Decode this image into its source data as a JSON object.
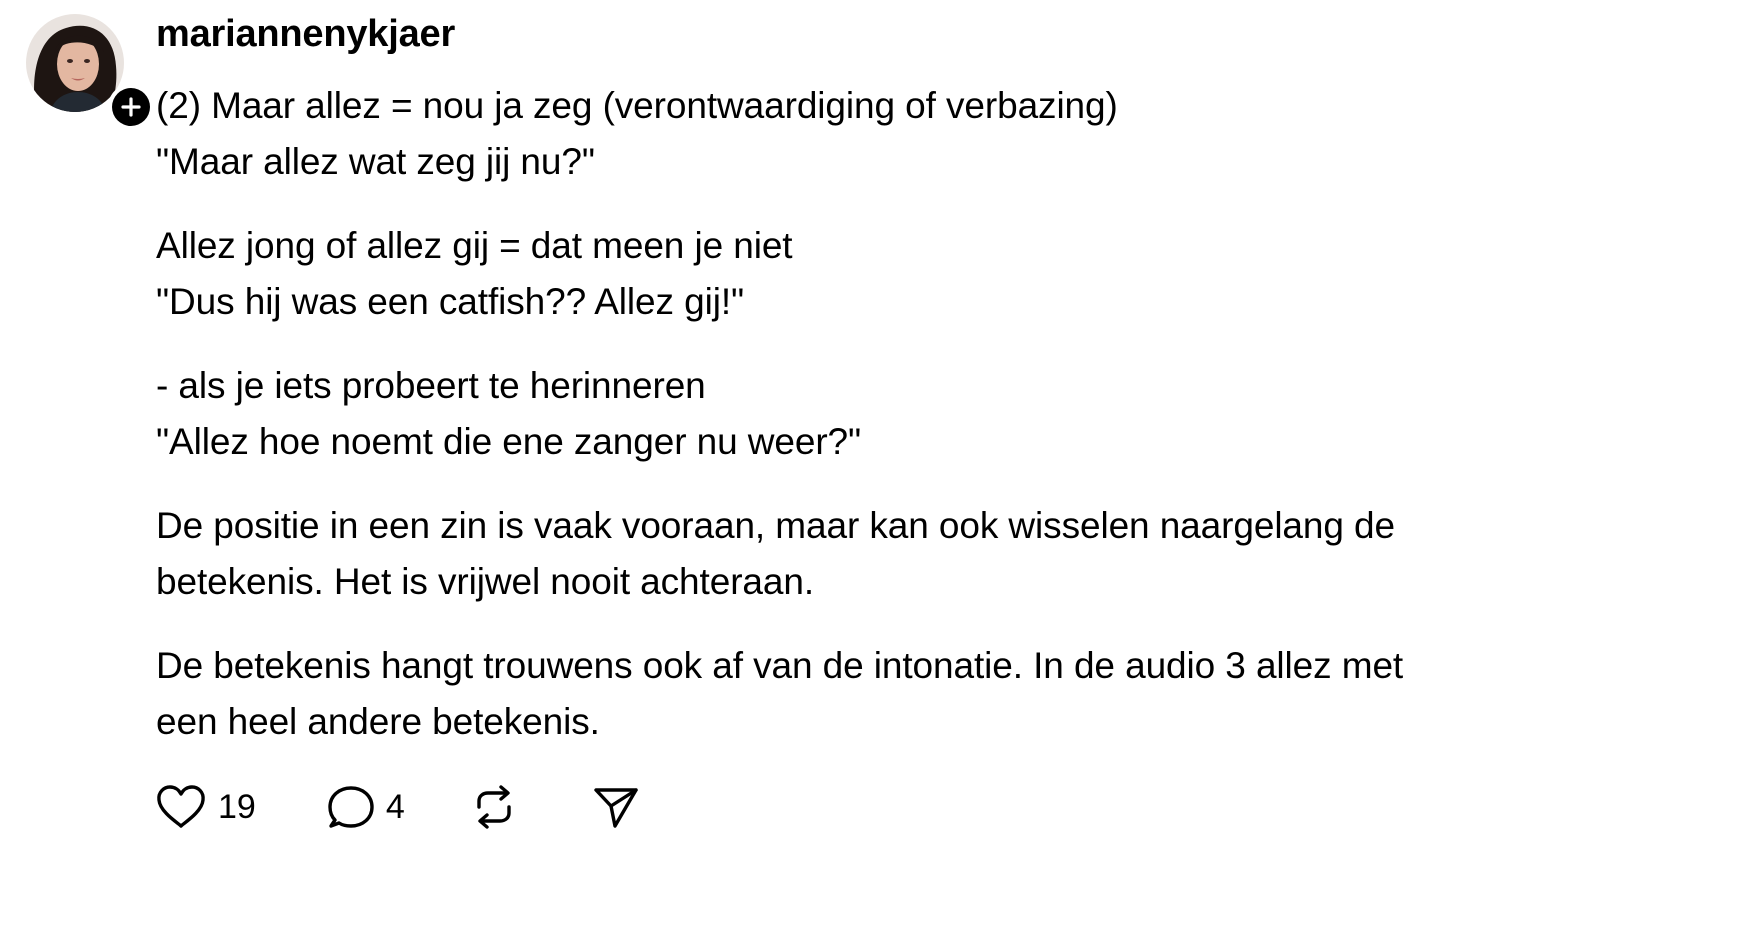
{
  "post": {
    "username": "mariannenykjaer",
    "paragraphs": [
      {
        "lines": [
          "(2) Maar allez = nou ja zeg (verontwaardiging of verbazing)",
          "\"Maar allez wat zeg jij nu?\""
        ]
      },
      {
        "lines": [
          "Allez jong of allez gij = dat meen je niet",
          "\"Dus hij was een catfish?? Allez gij!\""
        ]
      },
      {
        "lines": [
          "- als je iets probeert te herinneren",
          "\"Allez hoe noemt die ene zanger nu weer?\""
        ]
      },
      {
        "lines": [
          "De positie in een zin is vaak vooraan, maar kan ook wisselen naargelang de",
          "betekenis. Het is vrijwel nooit achteraan."
        ]
      },
      {
        "lines": [
          "De betekenis hangt trouwens ook af van de intonatie. In de audio 3 allez met",
          "een heel andere betekenis."
        ]
      }
    ]
  },
  "actions": {
    "like_count": "19",
    "reply_count": "4",
    "like_icon": "heart-icon",
    "reply_icon": "speech-bubble-icon",
    "repost_icon": "repost-icon",
    "share_icon": "paper-plane-icon"
  },
  "avatar": {
    "follow_icon": "plus-icon"
  }
}
